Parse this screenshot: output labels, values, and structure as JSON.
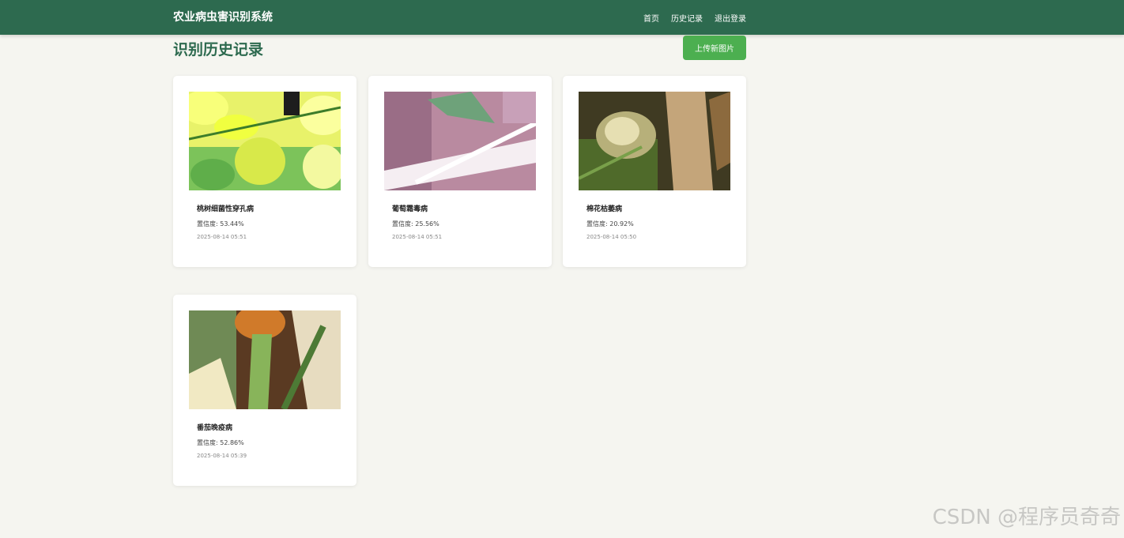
{
  "navbar": {
    "brand": "农业病虫害识别系统",
    "links": [
      "首页",
      "历史记录",
      "退出登录"
    ]
  },
  "page": {
    "title": "识别历史记录",
    "upload_label": "上传新图片"
  },
  "records": [
    {
      "name": "桃树细菌性穿孔病",
      "confidence": "置信度: 53.44%",
      "time": "2025-08-14 05:51"
    },
    {
      "name": "葡萄霜毒病",
      "confidence": "置信度: 25.56%",
      "time": "2025-08-14 05:51"
    },
    {
      "name": "棉花枯萎病",
      "confidence": "置信度: 20.92%",
      "time": "2025-08-14 05:50"
    },
    {
      "name": "番茄晚疫病",
      "confidence": "置信度: 52.86%",
      "time": "2025-08-14 05:39"
    }
  ],
  "watermark": "CSDN @程序员奇奇"
}
